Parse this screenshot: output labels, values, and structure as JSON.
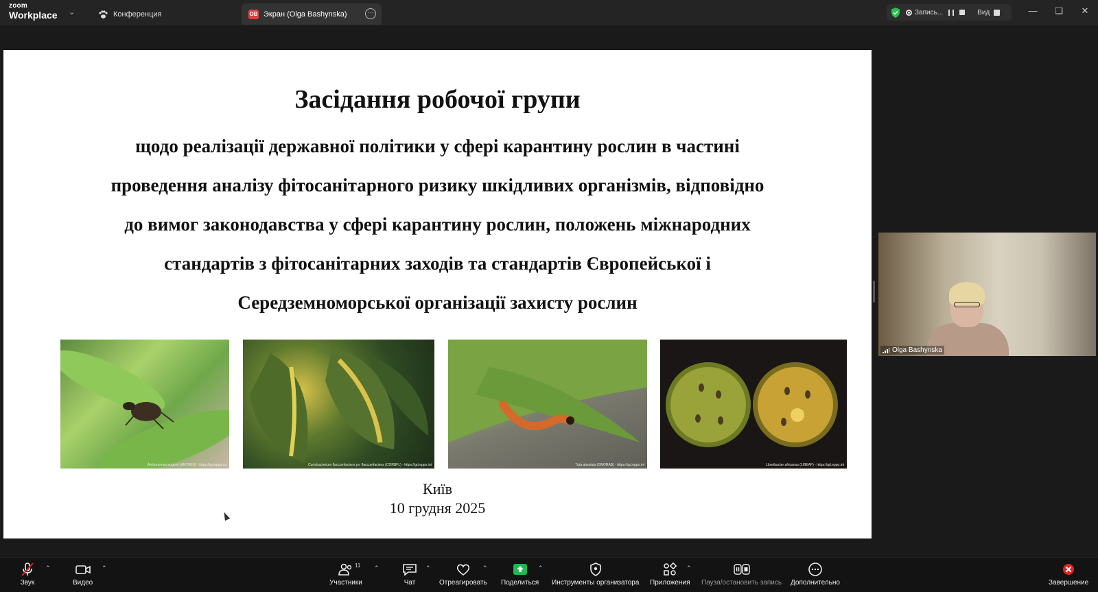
{
  "app": {
    "logo_line1": "zoom",
    "logo_line2": "Workplace"
  },
  "tabs": [
    {
      "label": "Конференция"
    },
    {
      "label": "Экран (Olga Bashynska)",
      "badge": "OB"
    }
  ],
  "recording": {
    "label": "Запись...",
    "view_label": "Вид"
  },
  "slide": {
    "title": "Засідання робочої групи",
    "subtitle_lines": [
      "щодо реалізації державної політики у сфері карантину рослин в частині",
      "проведення аналізу фітосанітарного ризику шкідливих організмів, відповідно",
      "до вимог законодавства у сфері карантину рослин, положень міжнародних",
      "стандартів з фітосанітарних заходів та стандартів Європейської і",
      "Середземноморської організації захисту рослин"
    ],
    "photo_captions": [
      "Anthonomus eugenii (ANTHEU) - https://gd.eppo.int",
      "Curtobacterium flaccumfaciens pv. flaccumfaciens (CORBFL) - https://gd.eppo.int",
      "Tuta absoluta (GNORAB) - https://gd.eppo.int",
      "Liberibacter africanus (LIBEAF) - https://gd.eppo.int"
    ],
    "city": "Київ",
    "date": "10 грудня 2025"
  },
  "participant": {
    "name": "Olga Bashynska"
  },
  "toolbar": {
    "audio": "Звук",
    "video": "Видео",
    "participants": "Участники",
    "participants_count": "11",
    "chat": "Чат",
    "react": "Отреагировать",
    "share": "Поделиться",
    "host_tools": "Инструменты организатора",
    "apps": "Приложения",
    "pause_record": "Пауза/остановить запись",
    "more": "Дополнительно",
    "end": "Завершение"
  },
  "colors": {
    "share_green": "#1db954",
    "end_red": "#e02424",
    "badge_red": "#e03e3e"
  }
}
